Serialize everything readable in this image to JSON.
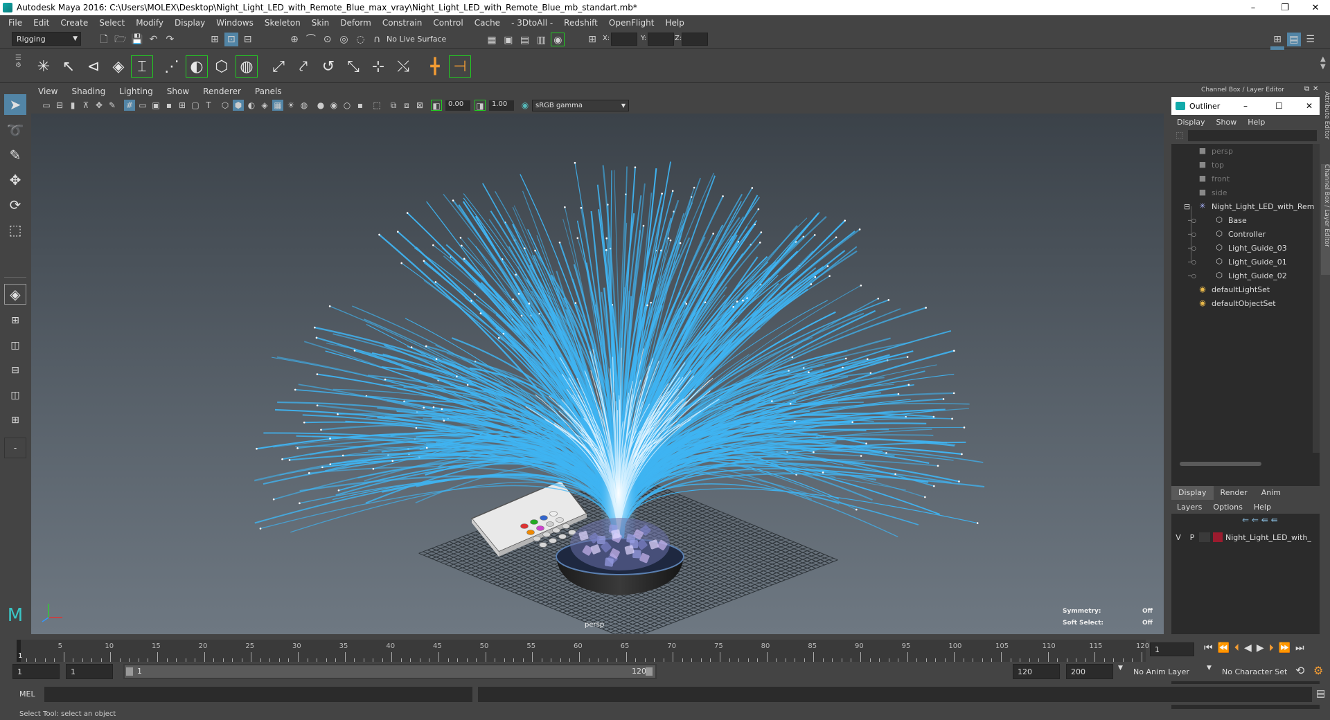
{
  "window": {
    "title": "Autodesk Maya 2016: C:\\Users\\MOLEX\\Desktop\\Night_Light_LED_with_Remote_Blue_max_vray\\Night_Light_LED_with_Remote_Blue_mb_standart.mb*",
    "minimize": "–",
    "restore": "❐",
    "close": "✕"
  },
  "menubar": [
    "File",
    "Edit",
    "Create",
    "Select",
    "Modify",
    "Display",
    "Windows",
    "Skeleton",
    "Skin",
    "Deform",
    "Constrain",
    "Control",
    "Cache",
    "- 3DtoAll -",
    "Redshift",
    "OpenFlight",
    "Help"
  ],
  "statusline": {
    "menuset": "Rigging",
    "live_surface": "No Live Surface",
    "x_label": "X:",
    "y_label": "Y:",
    "z_label": "Z:"
  },
  "viewport_menu": [
    "View",
    "Shading",
    "Lighting",
    "Show",
    "Renderer",
    "Panels"
  ],
  "viewport_tools": {
    "exposure": "0.00",
    "gamma": "1.00",
    "colorspace": "sRGB gamma"
  },
  "viewport": {
    "camera_label": "persp",
    "symmetry_label": "Symmetry:",
    "symmetry_value": "Off",
    "soft_select_label": "Soft Select:",
    "soft_select_value": "Off"
  },
  "channel_box_title": "Channel Box / Layer Editor",
  "side_tabs": [
    "Attribute Editor",
    "Channel Box / Layer Editor"
  ],
  "outliner": {
    "title": "Outliner",
    "menu": [
      "Display",
      "Show",
      "Help"
    ],
    "items": [
      {
        "label": "persp",
        "icon": "camera-icon",
        "indent": 0,
        "dim": true
      },
      {
        "label": "top",
        "icon": "camera-icon",
        "indent": 0,
        "dim": true
      },
      {
        "label": "front",
        "icon": "camera-icon",
        "indent": 0,
        "dim": true
      },
      {
        "label": "side",
        "icon": "camera-icon",
        "indent": 0,
        "dim": true
      },
      {
        "label": "Night_Light_LED_with_Rem",
        "icon": "group-icon",
        "indent": 0,
        "dim": false,
        "expand": "⊟"
      },
      {
        "label": "Base",
        "icon": "mesh-icon",
        "indent": 1,
        "dim": false
      },
      {
        "label": "Controller",
        "icon": "mesh-icon",
        "indent": 1,
        "dim": false
      },
      {
        "label": "Light_Guide_03",
        "icon": "mesh-icon",
        "indent": 1,
        "dim": false
      },
      {
        "label": "Light_Guide_01",
        "icon": "mesh-icon",
        "indent": 1,
        "dim": false
      },
      {
        "label": "Light_Guide_02",
        "icon": "mesh-icon",
        "indent": 1,
        "dim": false
      },
      {
        "label": "defaultLightSet",
        "icon": "set-icon",
        "indent": 0,
        "dim": false
      },
      {
        "label": "defaultObjectSet",
        "icon": "set-icon",
        "indent": 0,
        "dim": false
      }
    ]
  },
  "layer_editor": {
    "tabs": [
      "Display",
      "Render",
      "Anim"
    ],
    "menu": [
      "Layers",
      "Options",
      "Help"
    ],
    "layer": {
      "v": "V",
      "p": "P",
      "name": "Night_Light_LED_with_",
      "color": "#9b1b2e"
    }
  },
  "timeline": {
    "ticks": [
      "5",
      "10",
      "15",
      "20",
      "25",
      "30",
      "35",
      "40",
      "45",
      "50",
      "55",
      "60",
      "65",
      "70",
      "75",
      "80",
      "85",
      "90",
      "95",
      "100",
      "105",
      "110",
      "115",
      "120"
    ],
    "current_frame_marker": "1",
    "current_frame": "1"
  },
  "range": {
    "start": "1",
    "playback_start": "1",
    "slider_start": "1",
    "slider_end": "120",
    "playback_end": "120",
    "end": "200",
    "anim_layer": "No Anim Layer",
    "character_set": "No Character Set"
  },
  "cmdline": {
    "label": "MEL"
  },
  "helpline": "Select Tool: select an object",
  "colors": {
    "fiber": "#3fb4f2",
    "fiber_core": "#e8f7ff",
    "accent": "#5285a6",
    "panel": "#444444"
  }
}
